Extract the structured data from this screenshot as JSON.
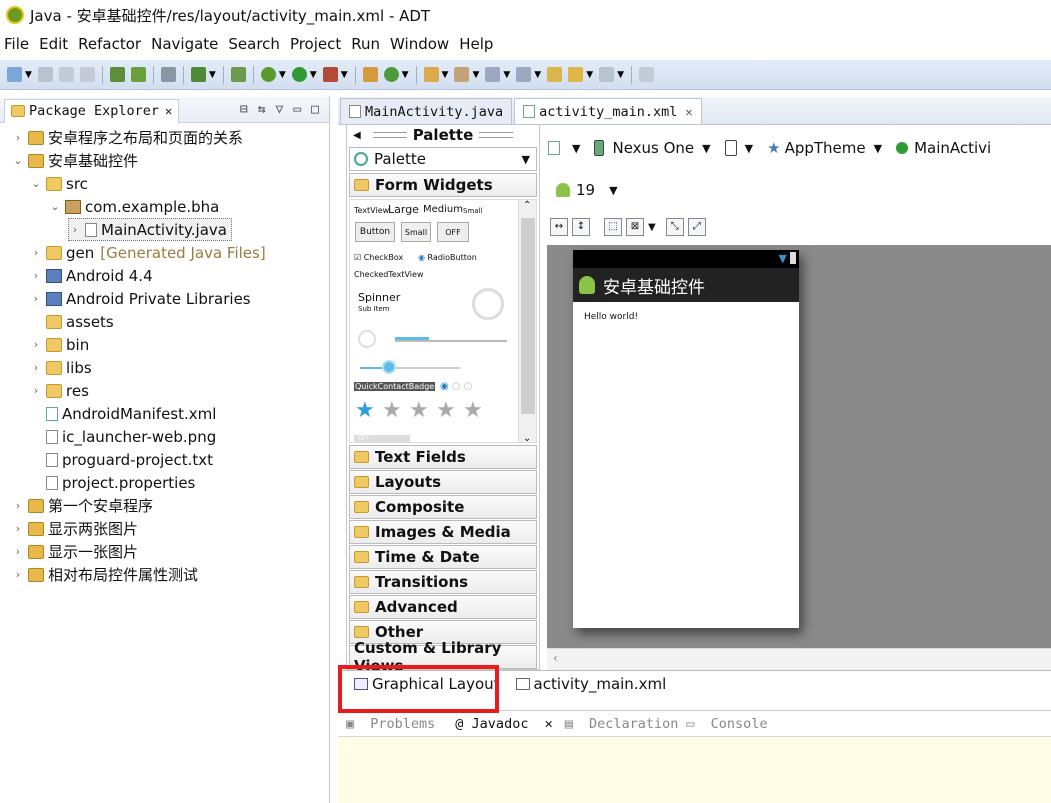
{
  "window": {
    "title": "Java - 安卓基础控件/res/layout/activity_main.xml - ADT"
  },
  "menu": [
    "File",
    "Edit",
    "Refactor",
    "Navigate",
    "Search",
    "Project",
    "Run",
    "Window",
    "Help"
  ],
  "package_explorer": {
    "tab_label": "Package Explorer",
    "items": [
      {
        "label": "安卓程序之布局和页面的关系"
      },
      {
        "label": "安卓基础控件"
      },
      {
        "label": "src"
      },
      {
        "label": "com.example.bha"
      },
      {
        "label": "MainActivity.java"
      },
      {
        "label": "gen",
        "suffix": "[Generated Java Files]"
      },
      {
        "label": "Android 4.4"
      },
      {
        "label": "Android Private Libraries"
      },
      {
        "label": "assets"
      },
      {
        "label": "bin"
      },
      {
        "label": "libs"
      },
      {
        "label": "res"
      },
      {
        "label": "AndroidManifest.xml"
      },
      {
        "label": "ic_launcher-web.png"
      },
      {
        "label": "proguard-project.txt"
      },
      {
        "label": "project.properties"
      },
      {
        "label": "第一个安卓程序"
      },
      {
        "label": "显示两张图片"
      },
      {
        "label": "显示一张图片"
      },
      {
        "label": "相对布局控件属性测试"
      }
    ]
  },
  "editor_tabs": [
    {
      "label": "MainActivity.java"
    },
    {
      "label": "activity_main.xml"
    }
  ],
  "palette": {
    "header": "Palette",
    "selector": "Palette",
    "open_category": "Form Widgets",
    "widgets": {
      "textview": "TextView",
      "large": "Large",
      "medium": "Medium",
      "small": "Small",
      "button": "Button",
      "small_button": "Small",
      "off": "OFF",
      "checkbox": "CheckBox",
      "radiobutton": "RadioButton",
      "checkedtextview": "CheckedTextView",
      "spinner": "Spinner",
      "subitem": "Sub Item",
      "quickcontact": "QuickContactBadge",
      "toggle_off": "OFF"
    },
    "categories": [
      "Text Fields",
      "Layouts",
      "Composite",
      "Images & Media",
      "Time & Date",
      "Transitions",
      "Advanced",
      "Other",
      "Custom & Library Views"
    ]
  },
  "canvas_toolbar": {
    "device": "Nexus One",
    "theme": "AppTheme",
    "activity": "MainActivi",
    "api": "19"
  },
  "device_preview": {
    "app_title": "安卓基础控件",
    "content_text": "Hello world!"
  },
  "bottom_editor_tabs": [
    {
      "label": "Graphical Layout"
    },
    {
      "label": "activity_main.xml"
    }
  ],
  "bottom_panel_tabs": [
    {
      "label": "Problems"
    },
    {
      "label": "@ Javadoc"
    },
    {
      "label": "Declaration"
    },
    {
      "label": "Console"
    }
  ],
  "colors": {
    "highlight_box": "#e81c1c",
    "toolbar_bg": "#dbe5f3",
    "canvas_bg": "#8a8a8a"
  }
}
